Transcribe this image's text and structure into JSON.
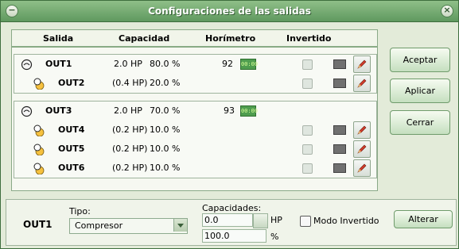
{
  "window": {
    "title": "Configuraciones de las salidas"
  },
  "table": {
    "headers": {
      "salida": "Salida",
      "capacidad": "Capacidad",
      "horimetro": "Horímetro",
      "invertido": "Invertido"
    },
    "rows": [
      {
        "name": "OUT1",
        "icon": "motor-icon",
        "capacity": "2.0 HP",
        "percent": "80.0 %",
        "hours": "92",
        "counter": "00:00"
      },
      {
        "name": "OUT2",
        "icon": "linked-output-icon",
        "capacity": "(0.4 HP)",
        "percent": "20.0 %",
        "hours": "",
        "counter": ""
      },
      {
        "name": "OUT3",
        "icon": "motor-icon",
        "capacity": "2.0 HP",
        "percent": "70.0 %",
        "hours": "93",
        "counter": "00:00"
      },
      {
        "name": "OUT4",
        "icon": "linked-output-icon",
        "capacity": "(0.2 HP)",
        "percent": "10.0 %",
        "hours": "",
        "counter": ""
      },
      {
        "name": "OUT5",
        "icon": "linked-output-icon",
        "capacity": "(0.2 HP)",
        "percent": "10.0 %",
        "hours": "",
        "counter": ""
      },
      {
        "name": "OUT6",
        "icon": "linked-output-icon",
        "capacity": "(0.2 HP)",
        "percent": "10.0 %",
        "hours": "",
        "counter": ""
      }
    ]
  },
  "buttons": {
    "accept": "Aceptar",
    "apply": "Aplicar",
    "close": "Cerrar",
    "alter": "Alterar"
  },
  "editor": {
    "output": "OUT1",
    "tipo_label": "Tipo:",
    "tipo_value": "Compresor",
    "capacidades_label": "Capacidades:",
    "hp_value": "0.0",
    "hp_unit": "HP",
    "percent_value": "100.0",
    "percent_unit": "%",
    "invert_label": "Modo Invertido"
  }
}
